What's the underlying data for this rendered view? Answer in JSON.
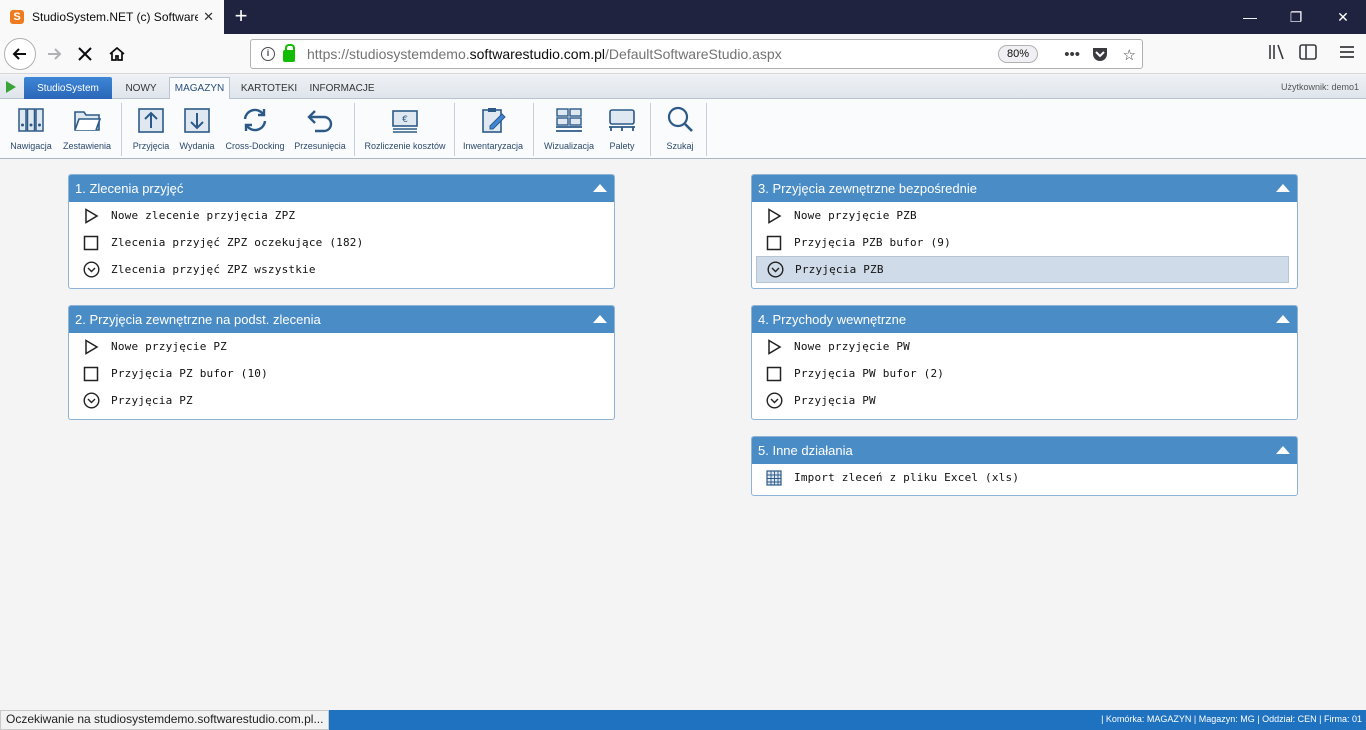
{
  "browser": {
    "tab_title": "StudioSystem.NET (c) Software",
    "favicon_letter": "S",
    "url_prefix": "https://studiosystemdemo.",
    "url_host": "softwarestudio.com.pl",
    "url_path": "/DefaultSoftwareStudio.aspx",
    "zoom": "80%",
    "status_text": "Oczekiwanie na studiosystemdemo.softwarestudio.com.pl..."
  },
  "menu": {
    "studio": "StudioSystem",
    "items": [
      "NOWY",
      "MAGAZYN",
      "KARTOTEKI",
      "INFORMACJE"
    ],
    "active": "MAGAZYN",
    "user": "Użytkownik: demo1"
  },
  "ribbon": {
    "buttons": [
      "Nawigacja",
      "Zestawienia",
      "Przyjęcia",
      "Wydania",
      "Cross-Docking",
      "Przesunięcia",
      "Rozliczenie kosztów",
      "Inwentaryzacja",
      "Wizualizacja",
      "Palety",
      "Szukaj"
    ]
  },
  "panels": {
    "p1": {
      "title": "1. Zlecenia przyjęć",
      "rows": [
        "Nowe zlecenie przyjęcia ZPZ",
        "Zlecenia przyjęć ZPZ oczekujące (182)",
        "Zlecenia przyjęć ZPZ wszystkie"
      ]
    },
    "p2": {
      "title": "2. Przyjęcia zewnętrzne na podst. zlecenia",
      "rows": [
        "Nowe przyjęcie PZ",
        "Przyjęcia PZ bufor (10)",
        "Przyjęcia PZ"
      ]
    },
    "p3": {
      "title": "3. Przyjęcia zewnętrzne bezpośrednie",
      "rows": [
        "Nowe przyjęcie PZB",
        "Przyjęcia PZB bufor (9)",
        "Przyjęcia PZB"
      ]
    },
    "p4": {
      "title": "4. Przychody wewnętrzne",
      "rows": [
        "Nowe przyjęcie PW",
        "Przyjęcia PW bufor (2)",
        "Przyjęcia PW"
      ]
    },
    "p5": {
      "title": "5. Inne działania",
      "rows": [
        "Import zleceń z pliku Excel (xls)"
      ]
    }
  },
  "statusbar": {
    "info": "| Komórka: MAGAZYN | Magazyn: MG | Oddział: CEN | Firma: 01"
  },
  "colors": {
    "panel_header": "#4a8cc6",
    "status_bar": "#1f72c0",
    "highlight_row": "#cfdbe8"
  }
}
